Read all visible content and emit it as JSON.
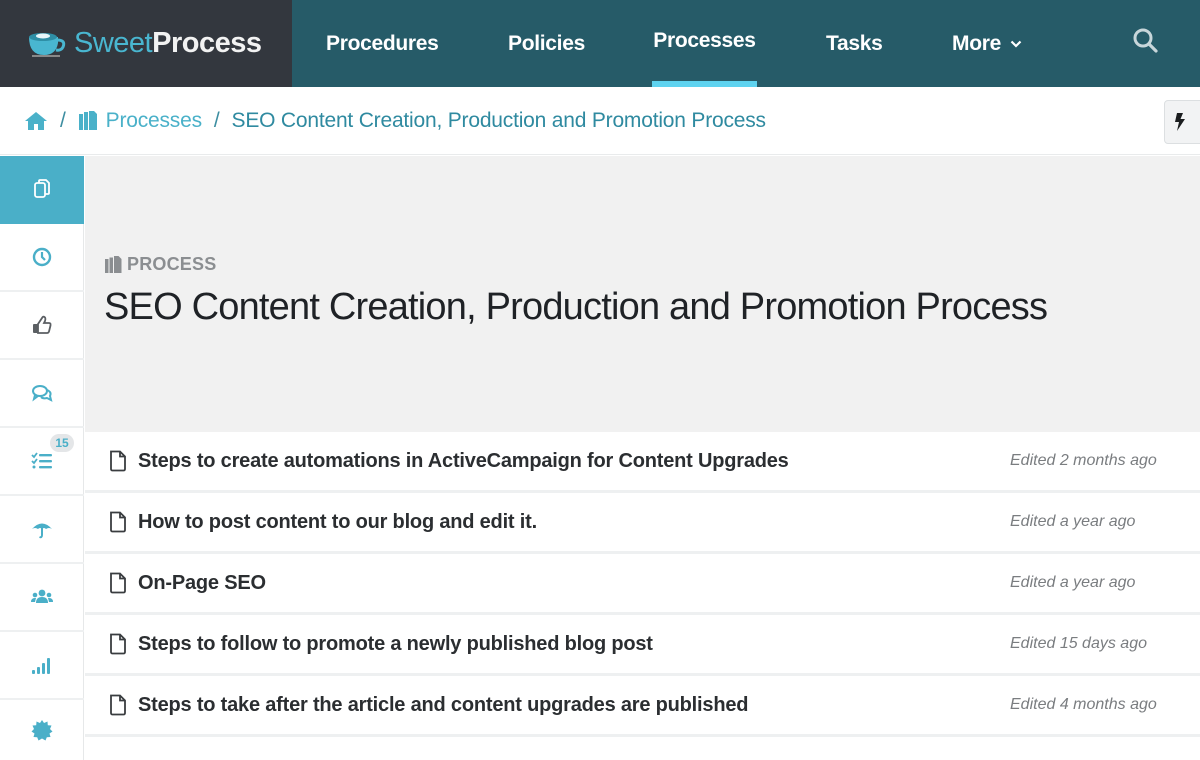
{
  "app": {
    "brand_part1": "Sweet",
    "brand_part2": "Process"
  },
  "nav": {
    "items": [
      {
        "label": "Procedures",
        "active": false
      },
      {
        "label": "Policies",
        "active": false
      },
      {
        "label": "Processes",
        "active": true
      },
      {
        "label": "Tasks",
        "active": false
      },
      {
        "label": "More",
        "active": false,
        "icon": "chevron-down-icon",
        "glyph": "⌄"
      }
    ],
    "search_icon": "search-icon"
  },
  "breadcrumb": {
    "home_icon": "home-icon",
    "separator": "/",
    "section_icon": "processes-icon",
    "section": "Processes",
    "current": "SEO Content Creation, Production and Promotion Process"
  },
  "toolbar": {
    "action_icon": "lightning-bolt-icon"
  },
  "sidebar": {
    "items": [
      {
        "icon": "copy-documents-icon",
        "active": true
      },
      {
        "icon": "clock-icon",
        "active": false
      },
      {
        "icon": "thumbs-up-icon",
        "active": false
      },
      {
        "icon": "comments-icon",
        "active": false
      },
      {
        "icon": "checklist-icon",
        "active": false,
        "badge": "15"
      },
      {
        "icon": "umbrella-icon",
        "active": false
      },
      {
        "icon": "users-icon",
        "active": false
      },
      {
        "icon": "signal-bars-icon",
        "active": false
      },
      {
        "icon": "certificate-icon",
        "active": false
      }
    ]
  },
  "header": {
    "kind_label": "PROCESS",
    "title": "SEO Content Creation, Production and Promotion Process"
  },
  "procedures": [
    {
      "name": "Steps to create automations in ActiveCampaign for Content Upgrades",
      "edited": "Edited 2 months ago"
    },
    {
      "name": "How to post content to our blog and edit it.",
      "edited": "Edited a year ago"
    },
    {
      "name": "On-Page SEO",
      "edited": "Edited a year ago"
    },
    {
      "name": "Steps to follow to promote a newly published blog post",
      "edited": "Edited 15 days ago"
    },
    {
      "name": "Steps to take after the article and content upgrades are published",
      "edited": "Edited 4 months ago"
    }
  ],
  "colors": {
    "nav_bg": "#265b68",
    "brand_bg": "#33373e",
    "accent": "#4aafc8",
    "active_tab_indicator": "#5ed3f0"
  }
}
